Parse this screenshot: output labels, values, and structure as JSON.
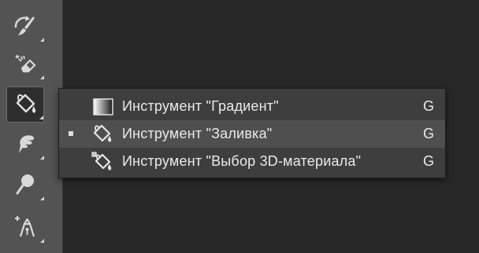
{
  "toolbar": {
    "tools": [
      {
        "icon": "history-brush-icon",
        "active": false
      },
      {
        "icon": "eraser-icon",
        "active": false
      },
      {
        "icon": "paint-bucket-icon",
        "active": true
      },
      {
        "icon": "smudge-icon",
        "active": false
      },
      {
        "icon": "dodge-icon",
        "active": false
      },
      {
        "icon": "pen-icon",
        "active": false
      }
    ]
  },
  "flyout": {
    "items": [
      {
        "label": "Инструмент \"Градиент\"",
        "shortcut": "G",
        "icon": "gradient-icon",
        "selected": false
      },
      {
        "label": "Инструмент \"Заливка\"",
        "shortcut": "G",
        "icon": "paint-bucket-icon",
        "selected": true
      },
      {
        "label": "Инструмент \"Выбор 3D-материала\"",
        "shortcut": "G",
        "icon": "3d-material-drop-icon",
        "selected": false
      }
    ]
  },
  "colors": {
    "toolbar_bg": "#535353",
    "canvas_bg": "#282828",
    "menu_bg": "#3e3e3e",
    "menu_selected_bg": "#4f4f4f",
    "text": "#eaeaea"
  }
}
